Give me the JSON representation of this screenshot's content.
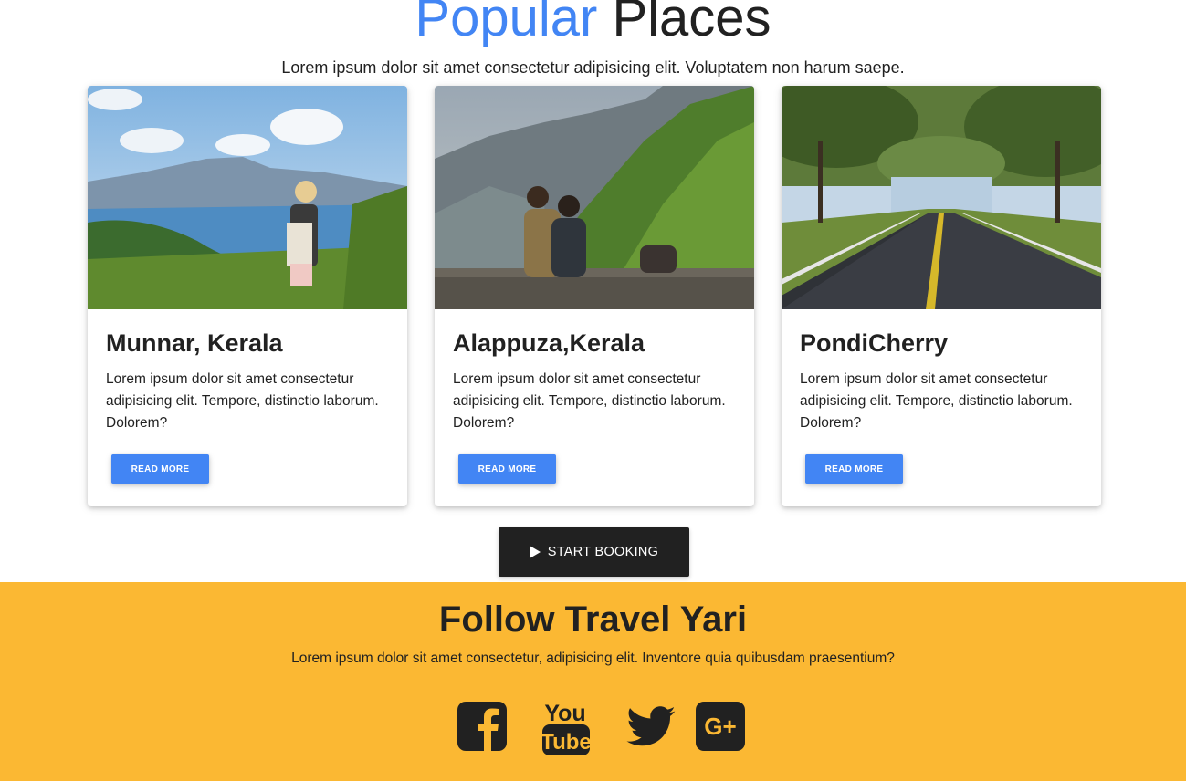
{
  "popular": {
    "title_accent": "Popular",
    "title_rest": "Places",
    "subtitle": "Lorem ipsum dolor sit amet consectetur adipisicing elit. Voluptatem non harum saepe."
  },
  "cards": [
    {
      "title": "Munnar, Kerala",
      "text": "Lorem ipsum dolor sit amet consectetur adipisicing elit. Tempore, distinctio laborum. Dolorem?",
      "button": "READ MORE"
    },
    {
      "title": "Alappuza,Kerala",
      "text": "Lorem ipsum dolor sit amet consectetur adipisicing elit. Tempore, distinctio laborum. Dolorem?",
      "button": "READ MORE"
    },
    {
      "title": "PondiCherry",
      "text": "Lorem ipsum dolor sit amet consectetur adipisicing elit. Tempore, distinctio laborum. Dolorem?",
      "button": "READ MORE"
    }
  ],
  "booking": {
    "label": "START BOOKING",
    "icon": "play-icon"
  },
  "follow": {
    "title": "Follow Travel Yari",
    "subtitle": "Lorem ipsum dolor sit amet consectetur, adipisicing elit. Inventore quia quibusdam praesentium?",
    "icons": [
      "facebook-icon",
      "youtube-icon",
      "twitter-icon",
      "google-plus-icon"
    ],
    "youtube_you": "You",
    "youtube_tube": "Tube",
    "gplus_text": "G+"
  },
  "colors": {
    "accent": "#4285f4",
    "dark": "#212121",
    "follow_bg": "#fbb833"
  }
}
